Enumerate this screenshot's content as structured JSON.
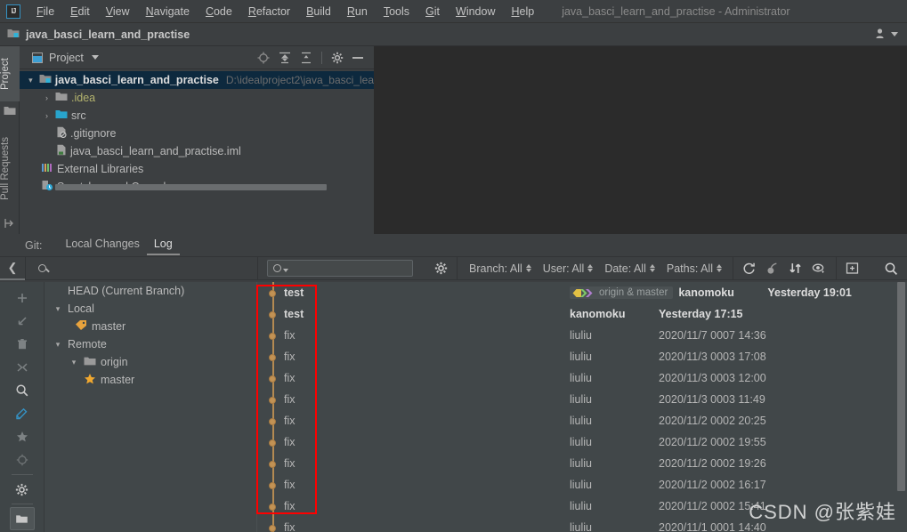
{
  "window": {
    "title": "java_basci_learn_and_practise - Administrator",
    "logo": "intellij-idea-logo",
    "menu": [
      "File",
      "Edit",
      "View",
      "Navigate",
      "Code",
      "Refactor",
      "Build",
      "Run",
      "Tools",
      "Git",
      "Window",
      "Help"
    ],
    "account_icon": "user-account-icon"
  },
  "project_strip": {
    "name": "java_basci_learn_and_practise",
    "folder_icon": "module-folder-icon"
  },
  "left_tool_strip": {
    "tabs": [
      {
        "label": "Project",
        "selected": true
      },
      {
        "label": "Pull Requests",
        "selected": false
      }
    ],
    "icons": [
      "folder-icon",
      "pull-request-icon"
    ]
  },
  "project_panel": {
    "title": "Project",
    "view_icon": "project-view-icon",
    "caret_icon": "chevron-down-icon",
    "tools": [
      "locate-icon",
      "expand-all-icon",
      "collapse-all-icon",
      "gear-icon",
      "hide-icon"
    ],
    "tree": [
      {
        "indent": 0,
        "chevron": "v",
        "icon": "module-folder-icon",
        "label": "java_basci_learn_and_practise",
        "bold": true,
        "path": "D:\\idealproject2\\java_basci_lea",
        "selected": true
      },
      {
        "indent": 1,
        "chevron": ">",
        "icon": "folder-icon-grey",
        "label": ".idea",
        "bold": false,
        "path": "",
        "selected": false
      },
      {
        "indent": 1,
        "chevron": ">",
        "icon": "folder-icon-blue",
        "label": "src",
        "bold": false,
        "path": "",
        "selected": false
      },
      {
        "indent": 1,
        "chevron": "",
        "icon": "gitignore-file-icon",
        "label": ".gitignore",
        "bold": false,
        "path": "",
        "selected": false
      },
      {
        "indent": 1,
        "chevron": "",
        "icon": "iml-file-icon",
        "label": "java_basci_learn_and_practise.iml",
        "bold": false,
        "path": "",
        "selected": false
      },
      {
        "indent": 0,
        "chevron": "",
        "icon": "external-libraries-icon",
        "label": "External Libraries",
        "bold": false,
        "path": "",
        "selected": false
      },
      {
        "indent": 0,
        "chevron": "",
        "icon": "scratches-icon",
        "label": "Scratches and Consoles",
        "bold": false,
        "path": "",
        "selected": false
      }
    ]
  },
  "git_panel": {
    "label": "Git:",
    "tabs": [
      {
        "label": "Local Changes",
        "selected": false
      },
      {
        "label": "Log",
        "selected": true
      }
    ],
    "toolbar": {
      "collapse_icon": "chevron-left-icon",
      "branch_search_icon": "search-icon",
      "search_placeholder": "",
      "search_value": "",
      "search_icon": "search-dropdown-icon",
      "gear_icon": "gear-icon",
      "filters": [
        {
          "label": "Branch: All"
        },
        {
          "label": "User: All"
        },
        {
          "label": "Date: All"
        },
        {
          "label": "Paths: All"
        }
      ],
      "actions": [
        "refresh-icon",
        "cherry-pick-icon",
        "sort-icon",
        "show-details-icon",
        "open-in-editor-icon",
        "find-icon"
      ]
    },
    "side_icons": [
      "plus-icon",
      "checkout-icon",
      "delete-icon",
      "merge-icon",
      "search-icon",
      "edit-icon",
      "favorite-star-icon",
      "target-icon",
      "gear-icon",
      "folder-toggle-icon"
    ],
    "branch_tree": [
      {
        "indent": 0,
        "chevron": "",
        "icon": "",
        "label": "HEAD (Current Branch)"
      },
      {
        "indent": 0,
        "chevron": "v",
        "icon": "",
        "label": "Local"
      },
      {
        "indent": 1,
        "chevron": "",
        "icon": "branch-tag-icon",
        "label": "master"
      },
      {
        "indent": 0,
        "chevron": "v",
        "icon": "",
        "label": "Remote"
      },
      {
        "indent": 1,
        "chevron": "v",
        "icon": "folder-icon-grey",
        "label": "origin"
      },
      {
        "indent": 2,
        "chevron": "",
        "icon": "favorite-star-icon",
        "label": "master"
      }
    ],
    "commits": [
      {
        "subject": "test",
        "bold": true,
        "badge": "origin & master",
        "author": "kanomoku",
        "date": "Yesterday 19:01"
      },
      {
        "subject": "test",
        "bold": true,
        "badge": "",
        "author": "kanomoku",
        "date": "Yesterday 17:15"
      },
      {
        "subject": "fix",
        "bold": false,
        "badge": "",
        "author": "liuliu",
        "date": "2020/11/7 0007 14:36"
      },
      {
        "subject": "fix",
        "bold": false,
        "badge": "",
        "author": "liuliu",
        "date": "2020/11/3 0003 17:08"
      },
      {
        "subject": "fix",
        "bold": false,
        "badge": "",
        "author": "liuliu",
        "date": "2020/11/3 0003 12:00"
      },
      {
        "subject": "fix",
        "bold": false,
        "badge": "",
        "author": "liuliu",
        "date": "2020/11/3 0003 11:49"
      },
      {
        "subject": "fix",
        "bold": false,
        "badge": "",
        "author": "liuliu",
        "date": "2020/11/2 0002 20:25"
      },
      {
        "subject": "fix",
        "bold": false,
        "badge": "",
        "author": "liuliu",
        "date": "2020/11/2 0002 19:55"
      },
      {
        "subject": "fix",
        "bold": false,
        "badge": "",
        "author": "liuliu",
        "date": "2020/11/2 0002 19:26"
      },
      {
        "subject": "fix",
        "bold": false,
        "badge": "",
        "author": "liuliu",
        "date": "2020/11/2 0002 16:17"
      },
      {
        "subject": "fix",
        "bold": false,
        "badge": "",
        "author": "liuliu",
        "date": "2020/11/2 0002 15:41"
      },
      {
        "subject": "fix",
        "bold": false,
        "badge": "",
        "author": "liuliu",
        "date": "2020/11/1 0001 14:40"
      }
    ]
  },
  "annotation": {
    "highlight_color": "#ff0000"
  },
  "watermark": {
    "text": "CSDN @张紫娃"
  },
  "colors": {
    "chrome": "#3c3f41",
    "editor": "#2b2b2b",
    "log_bg": "#414749",
    "selection": "#0d293e",
    "graph_orange": "#c29254",
    "accent_blue": "#3592c4"
  }
}
